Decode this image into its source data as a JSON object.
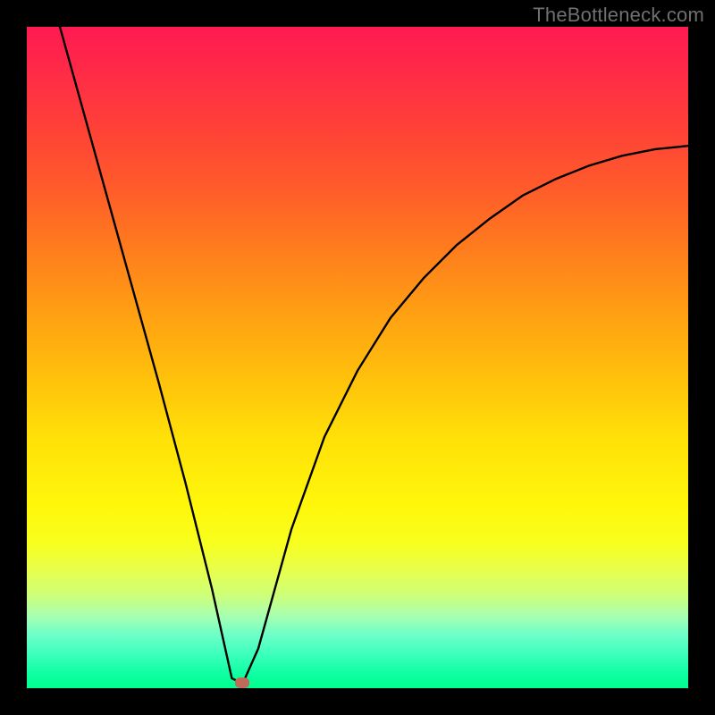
{
  "watermark": "TheBottleneck.com",
  "chart_data": {
    "type": "line",
    "title": "",
    "xlabel": "",
    "ylabel": "",
    "x_range": [
      0,
      100
    ],
    "y_range": [
      0,
      100
    ],
    "grid": false,
    "legend": false,
    "series": [
      {
        "name": "curve",
        "x": [
          5,
          10,
          15,
          20,
          24,
          28,
          30,
          31,
          32,
          33,
          35,
          40,
          45,
          50,
          55,
          60,
          65,
          70,
          75,
          80,
          85,
          90,
          95,
          100
        ],
        "y": [
          100,
          82,
          64,
          46,
          31,
          15,
          6,
          1.5,
          1,
          1.5,
          6,
          24,
          38,
          48,
          56,
          62,
          67,
          71,
          74.5,
          77,
          79,
          80.5,
          81.5,
          82
        ]
      }
    ],
    "annotations": [
      {
        "name": "marker",
        "x": 32.5,
        "y": 0.8,
        "color": "#c06a5a"
      }
    ],
    "background_gradient": {
      "orientation": "vertical",
      "stops": [
        {
          "pos": 0.0,
          "color": "#ff1a51"
        },
        {
          "pos": 0.33,
          "color": "#ff7a1e"
        },
        {
          "pos": 0.62,
          "color": "#ffe008"
        },
        {
          "pos": 0.82,
          "color": "#e8ff4a"
        },
        {
          "pos": 1.0,
          "color": "#00ff8c"
        }
      ]
    }
  }
}
